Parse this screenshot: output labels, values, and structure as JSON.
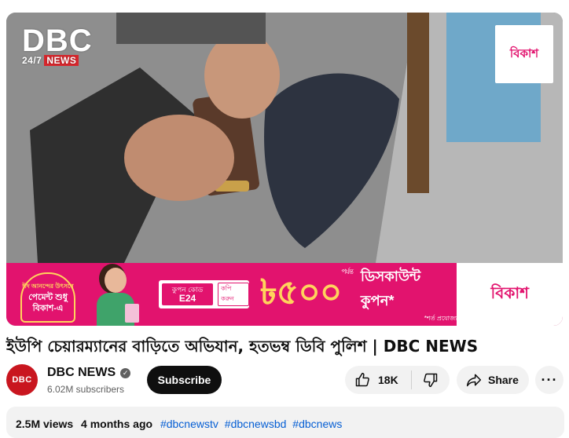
{
  "player": {
    "watermark_big": "DBC",
    "watermark_small": "24/7",
    "watermark_news": "NEWS",
    "corner_logo": "বিকাশ",
    "banner": {
      "offer_line1": "ঈদ আনন্দের উৎসবে",
      "offer_line2": "পেমেন্ট শুধু",
      "offer_line3": "বিকাশ-এ",
      "coupon_label": "কুপন কোড",
      "coupon_code": "E24",
      "copy_label": "কপি করুন",
      "amount": "৳৫০০",
      "amount_suffix": "পর্যন্ত",
      "discount_text": "ডিসকাউন্ট কুপন*",
      "terms": "*শর্ত প্রযোজ্য",
      "brand": "বিকাশ"
    }
  },
  "video": {
    "title": "ইউপি চেয়ারম্যানের বাড়িতে অভিযান, হতভম্ব ডিবি পুলিশ | DBC NEWS"
  },
  "channel": {
    "avatar_text": "DBC",
    "name": "DBC NEWS",
    "subscribers": "6.02M subscribers",
    "subscribe_label": "Subscribe"
  },
  "actions": {
    "likes": "18K",
    "share_label": "Share",
    "more_label": "···"
  },
  "description": {
    "views": "2.5M views",
    "age": "4 months ago",
    "hashtags": [
      "#dbcnewstv",
      "#dbcnewsbd",
      "#dbcnews"
    ]
  },
  "colors": {
    "brand_pink": "#e2136e",
    "channel_red": "#c9161f",
    "link_blue": "#065fd4"
  }
}
